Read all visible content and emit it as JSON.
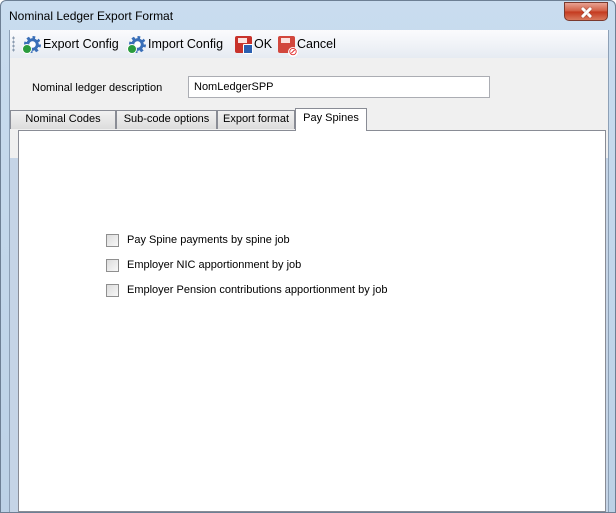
{
  "window": {
    "title": "Nominal Ledger Export Format"
  },
  "toolbar": {
    "export_label": "Export Config",
    "import_label": "Import Config",
    "ok_label": "OK",
    "cancel_label": "Cancel"
  },
  "description": {
    "label": "Nominal ledger description",
    "value": "NomLedgerSPP"
  },
  "tabs": [
    {
      "label": "Nominal Codes",
      "selected": false
    },
    {
      "label": "Sub-code options",
      "selected": false
    },
    {
      "label": "Export format",
      "selected": false
    },
    {
      "label": "Pay Spines",
      "selected": true
    }
  ],
  "options": [
    {
      "label": "Pay Spine payments by spine job",
      "checked": false
    },
    {
      "label": "Employer NIC apportionment by job",
      "checked": false
    },
    {
      "label": "Employer Pension contributions apportionment by job",
      "checked": false
    }
  ],
  "colors": {
    "frame": "#c9dcef",
    "panel": "#ffffff",
    "close_button": "#c4381d"
  }
}
